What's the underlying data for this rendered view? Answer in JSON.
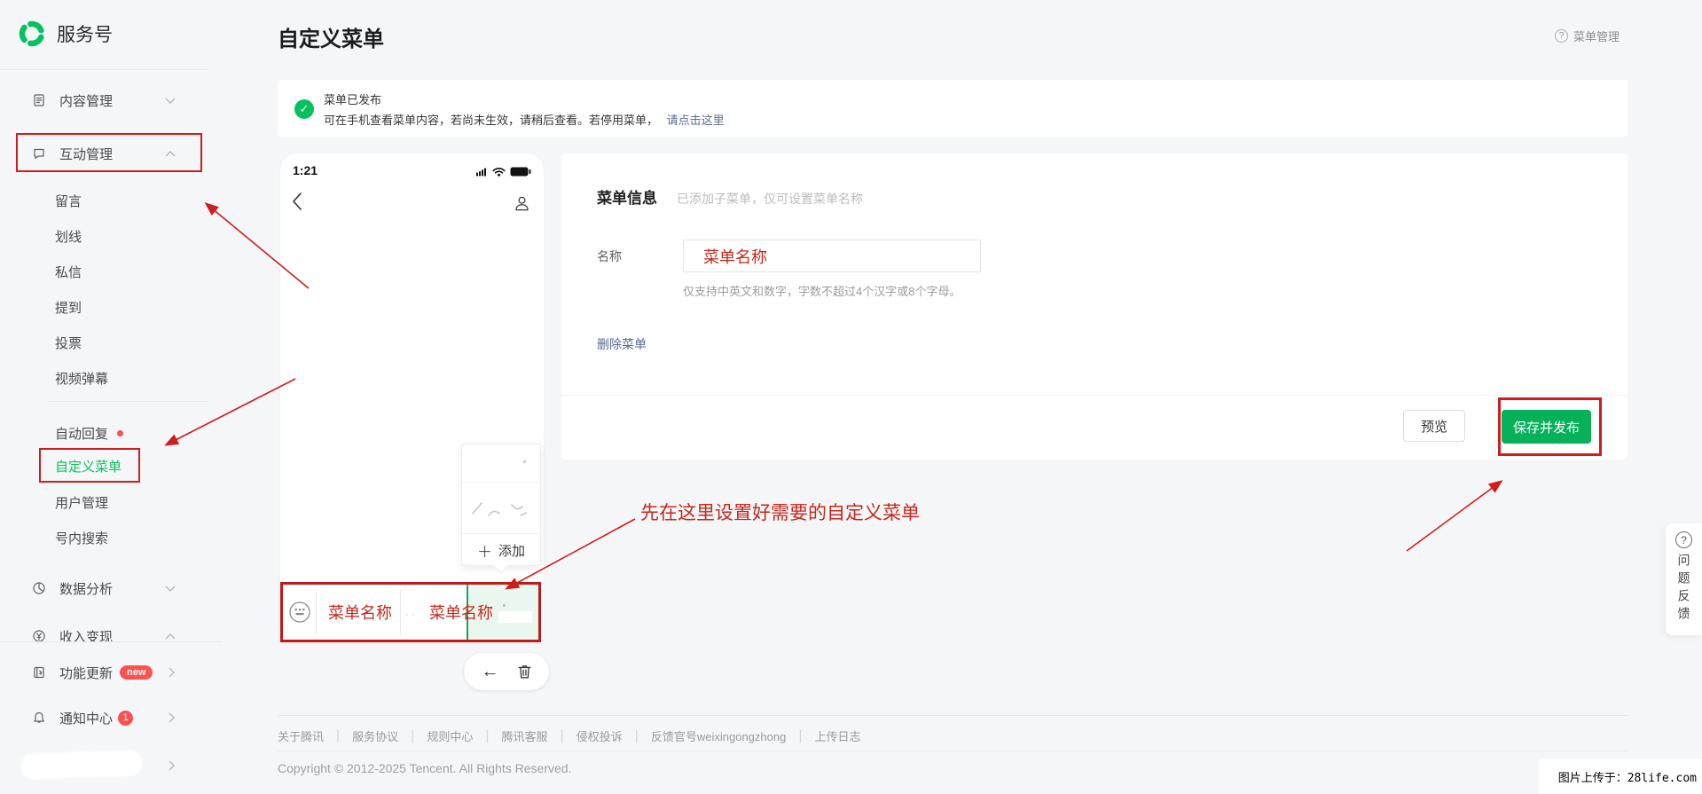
{
  "colors": {
    "accent_green": "#07c160",
    "annotation_red": "#cf1d1d",
    "badge_red": "#fa5151",
    "link_blue": "#576b95"
  },
  "sidebar": {
    "brand": "服务号",
    "items": [
      {
        "label": "内容管理"
      },
      {
        "label": "互动管理"
      },
      {
        "label": "留言"
      },
      {
        "label": "划线"
      },
      {
        "label": "私信"
      },
      {
        "label": "提到"
      },
      {
        "label": "投票"
      },
      {
        "label": "视频弹幕"
      },
      {
        "label": "自动回复"
      },
      {
        "label": "自定义菜单"
      },
      {
        "label": "用户管理"
      },
      {
        "label": "号内搜索"
      },
      {
        "label": "数据分析"
      },
      {
        "label": "收入变现"
      },
      {
        "label": "功能更新",
        "badge": "new"
      },
      {
        "label": "通知中心",
        "badge": "1"
      }
    ]
  },
  "header": {
    "title": "自定义菜单",
    "help": "菜单管理"
  },
  "banner": {
    "title": "菜单已发布",
    "desc": "可在手机查看菜单内容，若尚未生效，请稍后查看。若停用菜单，",
    "link": "请点击这里"
  },
  "phone": {
    "time": "1:21",
    "dropdown_add": "添加",
    "menu_item_1": "菜单名称",
    "menu_item_2": "菜单名称"
  },
  "form": {
    "section_title": "菜单信息",
    "section_hint": "已添加子菜单，仅可设置菜单名称",
    "name_label": "名称",
    "name_value": "菜单名称",
    "name_hint": "仅支持中英文和数字，字数不超过4个汉字或8个字母。",
    "delete_link": "删除菜单",
    "preview_button": "预览",
    "save_button": "保存并发布"
  },
  "annotation": {
    "tip": "先在这里设置好需要的自定义菜单"
  },
  "feedback": {
    "label": "问题反馈"
  },
  "footer": {
    "links": [
      "关于腾讯",
      "服务协议",
      "规则中心",
      "腾讯客服",
      "侵权投诉",
      "反馈官号weixingongzhong",
      "上传日志"
    ],
    "separator": "|",
    "copyright": "Copyright © 2012-2025 Tencent. All Rights Reserved."
  },
  "watermark": {
    "text": "图片上传于：28life.com"
  }
}
